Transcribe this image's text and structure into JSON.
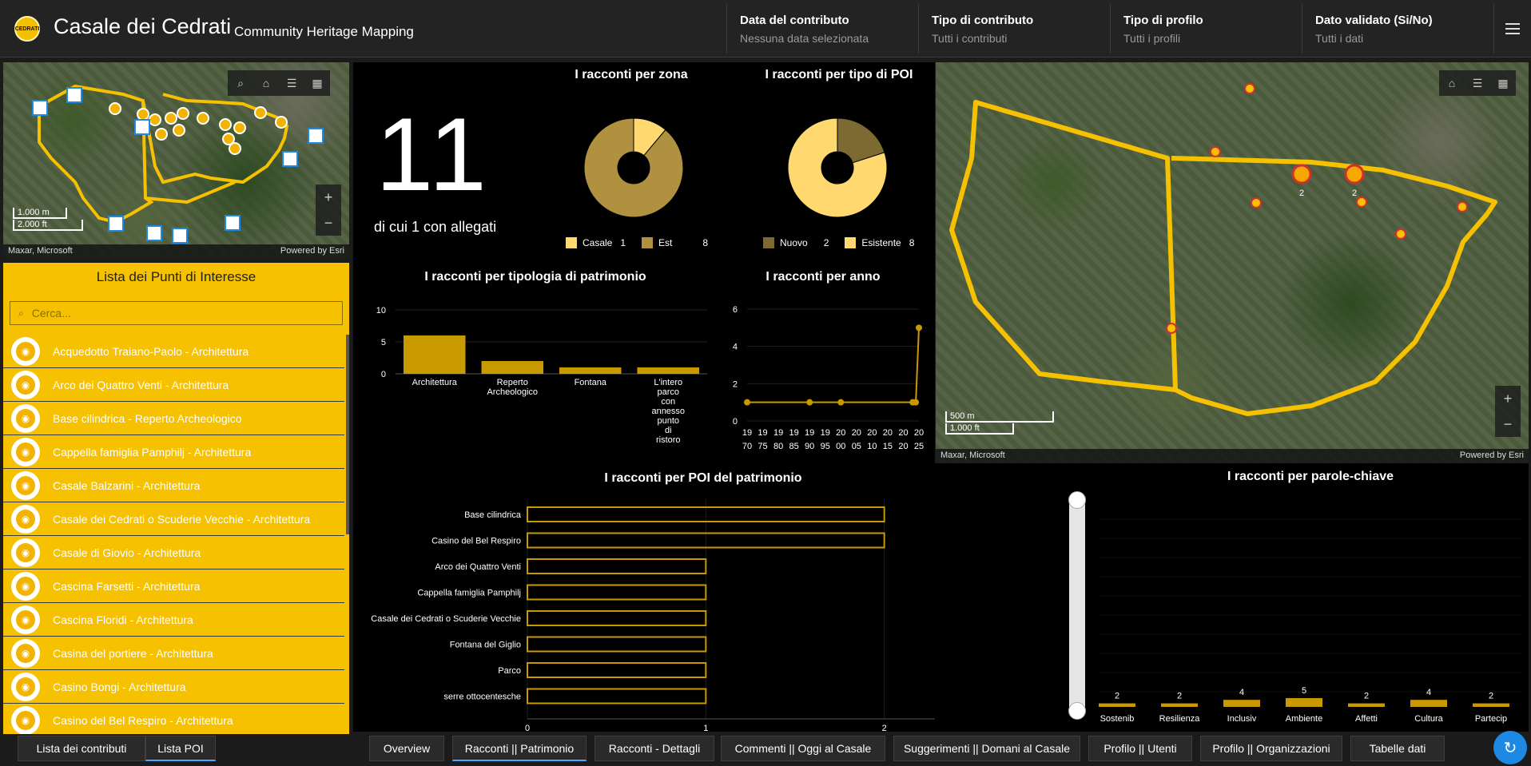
{
  "header": {
    "logo_text": "CEDRATI",
    "title": "Casale dei Cedrati",
    "subtitle": "Community Heritage Mapping",
    "filters": [
      {
        "label": "Data del contributo",
        "value": "Nessuna data selezionata"
      },
      {
        "label": "Tipo di contributo",
        "value": "Tutti i contributi"
      },
      {
        "label": "Tipo di profilo",
        "value": "Tutti i profili"
      },
      {
        "label": "Dato validato (Si/No)",
        "value": "Tutti i dati"
      }
    ]
  },
  "small_map": {
    "attribution": "Maxar, Microsoft",
    "powered": "Powered by Esri",
    "scale_top": "1.000 m",
    "scale_bottom": "2.000 ft"
  },
  "big_map": {
    "attribution": "Maxar, Microsoft",
    "powered": "Powered by Esri",
    "scale_top": "500 m",
    "scale_bottom": "1.000 ft",
    "marker_counts": [
      "2",
      "2"
    ]
  },
  "poi_panel": {
    "title": "Lista dei Punti di Interesse",
    "search_placeholder": "Cerca...",
    "items": [
      "Acquedotto Traiano-Paolo - Architettura",
      "Arco dei Quattro Venti - Architettura",
      "Base cilindrica - Reperto Archeologico",
      "Cappella famiglia Pamphilj - Architettura",
      "Casale Balzarini - Architettura",
      "Casale dei Cedrati o Scuderie Vecchie - Architettura",
      "Casale di Giovio - Architettura",
      "Cascina Farsetti - Architettura",
      "Cascina Floridi - Architettura",
      "Casina del portiere - Architettura",
      "Casino Bongi - Architettura",
      "Casino del Bel Respiro - Architettura"
    ]
  },
  "indicator": {
    "value": "11",
    "subtitle": "di cui 1 con allegati"
  },
  "colors": {
    "accent": "#f5c100",
    "bar_gold": "#c99a00",
    "casale": "#ffd870",
    "est": "#b0913f",
    "nuovo": "#7d6a33",
    "esistente": "#ffd870",
    "refresh": "#1e88e5"
  },
  "chart_data": [
    {
      "type": "pie",
      "title": "I racconti per zona",
      "categories": [
        "Casale",
        "Est"
      ],
      "values": [
        1,
        8
      ]
    },
    {
      "type": "pie",
      "title": "I racconti per tipo di POI",
      "categories": [
        "Nuovo",
        "Esistente"
      ],
      "values": [
        2,
        8
      ]
    },
    {
      "type": "bar",
      "title": "I racconti per tipologia di patrimonio",
      "categories": [
        "Architettura",
        "Reperto Archeologico",
        "Fontana",
        "L'intero parco con annesso punto di ristoro"
      ],
      "values": [
        6,
        2,
        1,
        1
      ],
      "ylim": [
        0,
        10
      ],
      "yticks": [
        "10",
        "5",
        "0"
      ],
      "cat_lines": [
        [
          "Architettura"
        ],
        [
          "Reperto",
          "Archeologico"
        ],
        [
          "Fontana"
        ],
        [
          "L'intero",
          "parco",
          "con",
          "annesso",
          "punto",
          "di",
          "ristoro"
        ]
      ]
    },
    {
      "type": "line",
      "title": "I racconti per anno",
      "x": [
        1970,
        1990,
        2000,
        2023,
        2025
      ],
      "values": [
        1,
        1,
        1,
        1,
        5
      ],
      "ylim": [
        0,
        6
      ],
      "yticks": [
        "6",
        "4",
        "2",
        "0"
      ],
      "xticks_top": [
        "19",
        "19",
        "19",
        "19",
        "19",
        "19",
        "20",
        "20",
        "20",
        "20",
        "20",
        "20",
        "20"
      ],
      "xticks_bottom": [
        "70",
        "75",
        "80",
        "85",
        "90",
        "95",
        "00",
        "05",
        "10",
        "15",
        "20",
        "25"
      ],
      "xtick_pairs": [
        [
          "19",
          "70"
        ],
        [
          "19",
          "75"
        ],
        [
          "19",
          "80"
        ],
        [
          "19",
          "85"
        ],
        [
          "19",
          "90"
        ],
        [
          "19",
          "95"
        ],
        [
          "20",
          "00"
        ],
        [
          "20",
          "05"
        ],
        [
          "20",
          "10"
        ],
        [
          "20",
          "15"
        ],
        [
          "20",
          "20"
        ],
        [
          "20",
          "25"
        ]
      ]
    },
    {
      "type": "bar",
      "orientation": "horizontal",
      "title": "I racconti per POI del patrimonio",
      "categories": [
        "Base cilindrica",
        "Casino del Bel Respiro",
        "Arco dei Quattro Venti",
        "Cappella famiglia Pamphilj",
        "Casale dei Cedrati o Scuderie Vecchie",
        "Fontana del Giglio",
        "Parco",
        "serre ottocentesche"
      ],
      "values": [
        2,
        2,
        1,
        1,
        1,
        1,
        1,
        1
      ],
      "xlim": [
        0,
        3
      ],
      "xticks": [
        "0",
        "1",
        "2",
        "3"
      ]
    },
    {
      "type": "bar",
      "title": "I racconti per parole-chiave",
      "categories": [
        "Sostenib",
        "Resilienza",
        "Inclusiv",
        "Ambiente",
        "Affetti",
        "Cultura",
        "Partecip"
      ],
      "values": [
        2,
        2,
        4,
        5,
        2,
        4,
        2
      ],
      "labels": [
        "2",
        "2",
        "4",
        "5",
        "2",
        "4",
        "2"
      ]
    }
  ],
  "legend": {
    "zona": [
      {
        "label": "Casale",
        "value": "1"
      },
      {
        "label": "Est",
        "value": "8"
      }
    ],
    "tipo": [
      {
        "label": "Nuovo",
        "value": "2"
      },
      {
        "label": "Esistente",
        "value": "8"
      }
    ]
  },
  "left_tabs": [
    "Lista dei contributi",
    "Lista POI"
  ],
  "bottom_tabs": [
    "Overview",
    "Racconti || Patrimonio",
    "Racconti - Dettagli",
    "Commenti || Oggi al Casale",
    "Suggerimenti || Domani al Casale",
    "Profilo || Utenti",
    "Profilo || Organizzazioni",
    "Tabelle dati"
  ],
  "icons": {
    "search": "search-icon",
    "home": "home-icon",
    "legend": "legend-icon",
    "layers": "layers-icon",
    "camera": "camera-icon",
    "refresh": "refresh-icon",
    "menu": "menu-icon"
  }
}
